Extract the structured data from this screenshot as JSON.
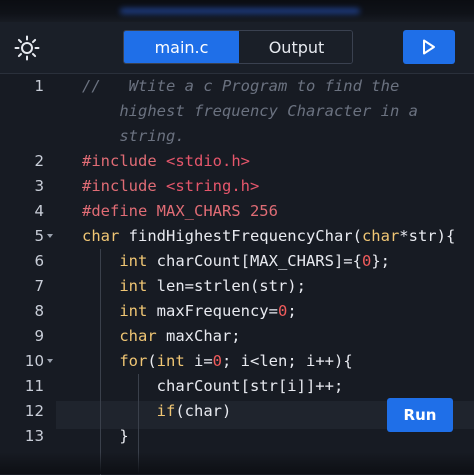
{
  "toolbar": {
    "tabs": [
      {
        "label": "main.c",
        "active": true
      },
      {
        "label": "Output",
        "active": false
      }
    ],
    "theme_icon": "sun-icon",
    "run_icon": "play-icon"
  },
  "editor": {
    "lines": [
      {
        "n": "1",
        "parts": [
          [
            "c-comment",
            "//   Wtite a c Program to find the"
          ]
        ]
      },
      {
        "n": "",
        "parts": [
          [
            "c-comment",
            "    highest frequency Character in a"
          ]
        ]
      },
      {
        "n": "",
        "parts": [
          [
            "c-comment",
            "    string."
          ]
        ]
      },
      {
        "n": "2",
        "parts": [
          [
            "c-pre",
            "#include "
          ],
          [
            "c-str",
            "<stdio.h>"
          ]
        ]
      },
      {
        "n": "3",
        "parts": [
          [
            "c-pre",
            "#include "
          ],
          [
            "c-str",
            "<string.h>"
          ]
        ]
      },
      {
        "n": "4",
        "parts": [
          [
            "c-pre",
            "#define MAX_CHARS 256"
          ]
        ]
      },
      {
        "n": "5",
        "fold": true,
        "parts": [
          [
            "c-kw",
            "char"
          ],
          [
            "c-fn",
            " findHighestFrequencyChar("
          ],
          [
            "c-kw",
            "char"
          ],
          [
            "c-fn",
            "*str){"
          ]
        ]
      },
      {
        "n": "6",
        "parts": [
          [
            "c-fn",
            "    "
          ],
          [
            "c-kw",
            "int"
          ],
          [
            "c-fn",
            " charCount[MAX_CHARS]={"
          ],
          [
            "c-num",
            "0"
          ],
          [
            "c-fn",
            "};"
          ]
        ]
      },
      {
        "n": "7",
        "parts": [
          [
            "c-fn",
            "    "
          ],
          [
            "c-kw",
            "int"
          ],
          [
            "c-fn",
            " len=strlen(str);"
          ]
        ]
      },
      {
        "n": "8",
        "parts": [
          [
            "c-fn",
            "    "
          ],
          [
            "c-kw",
            "int"
          ],
          [
            "c-fn",
            " maxFrequency="
          ],
          [
            "c-num",
            "0"
          ],
          [
            "c-fn",
            ";"
          ]
        ]
      },
      {
        "n": "9",
        "parts": [
          [
            "c-fn",
            "    "
          ],
          [
            "c-kw",
            "char"
          ],
          [
            "c-fn",
            " maxChar;"
          ]
        ]
      },
      {
        "n": "10",
        "fold": true,
        "parts": [
          [
            "c-fn",
            "    "
          ],
          [
            "c-kw",
            "for"
          ],
          [
            "c-fn",
            "("
          ],
          [
            "c-kw",
            "int"
          ],
          [
            "c-fn",
            " i="
          ],
          [
            "c-num",
            "0"
          ],
          [
            "c-fn",
            "; i<len; i++){"
          ]
        ]
      },
      {
        "n": "11",
        "parts": [
          [
            "c-fn",
            "        charCount[str[i]]++;"
          ]
        ]
      },
      {
        "n": "12",
        "parts": [
          [
            "c-fn",
            "        "
          ],
          [
            "c-kw",
            "if"
          ],
          [
            "c-fn",
            "(char)"
          ]
        ]
      },
      {
        "n": "13",
        "parts": [
          [
            "c-fn",
            "    }"
          ]
        ]
      }
    ]
  },
  "run_button": {
    "label": "Run"
  },
  "colors": {
    "accent": "#1f6fe8",
    "background": "#171b23",
    "keyword": "#f0c674",
    "string": "#e5566b",
    "number": "#f25c5c",
    "comment": "#6b7280"
  }
}
